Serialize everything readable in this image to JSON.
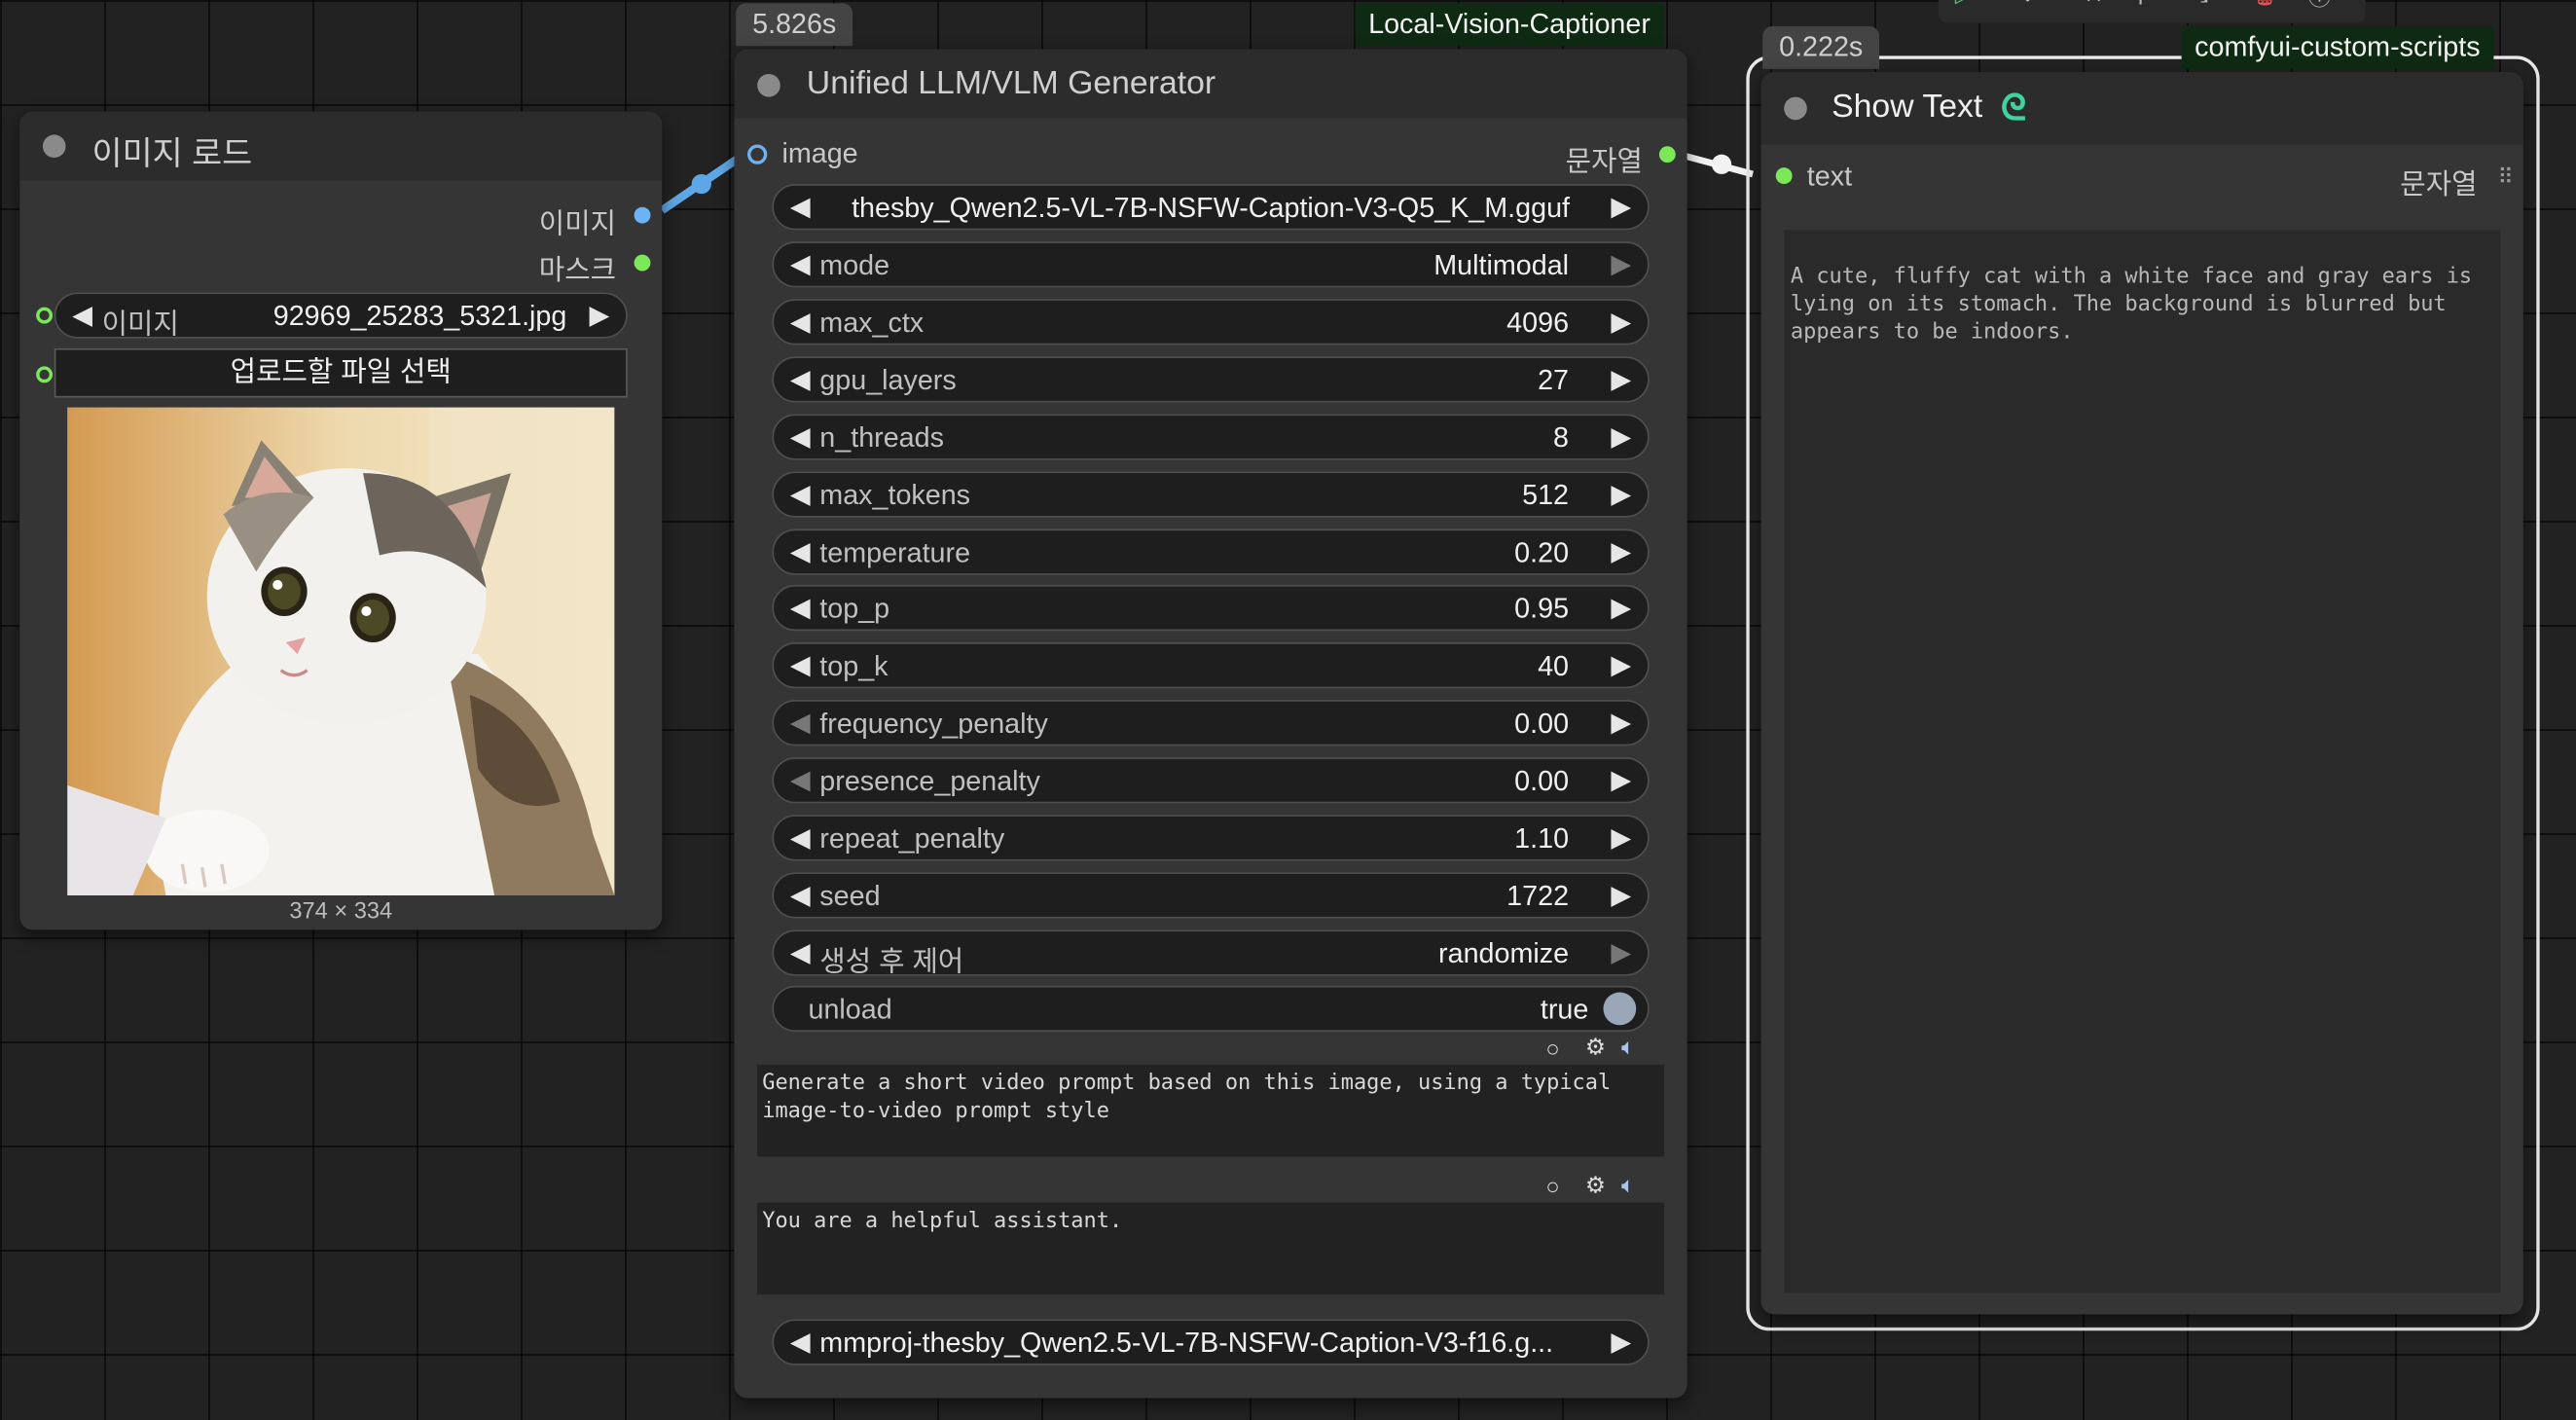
{
  "load_image": {
    "title": "이미지 로드",
    "outputs": [
      "이미지",
      "마스크"
    ],
    "image_widget_label": "이미지",
    "image_widget_value": "92969_25283_5321.jpg",
    "upload_button": "업로드할 파일 선택",
    "image_size": "374 × 334"
  },
  "generator": {
    "timing": "5.826s",
    "group_tag": "Local-Vision-Captioner",
    "title": "Unified LLM/VLM Generator",
    "input_label": "image",
    "output_label": "문자열",
    "model": "thesby_Qwen2.5-VL-7B-NSFW-Caption-V3-Q5_K_M.gguf",
    "params": [
      {
        "name": "mode",
        "value": "Multimodal"
      },
      {
        "name": "max_ctx",
        "value": "4096"
      },
      {
        "name": "gpu_layers",
        "value": "27"
      },
      {
        "name": "n_threads",
        "value": "8"
      },
      {
        "name": "max_tokens",
        "value": "512"
      },
      {
        "name": "temperature",
        "value": "0.20"
      },
      {
        "name": "top_p",
        "value": "0.95"
      },
      {
        "name": "top_k",
        "value": "40"
      },
      {
        "name": "frequency_penalty",
        "value": "0.00"
      },
      {
        "name": "presence_penalty",
        "value": "0.00"
      },
      {
        "name": "repeat_penalty",
        "value": "1.10"
      },
      {
        "name": "seed",
        "value": "1722"
      },
      {
        "name": "생성 후 제어",
        "value": "randomize"
      }
    ],
    "unload_label": "unload",
    "unload_value": "true",
    "prompt": "Generate a short video prompt based on this image, using a typical image-to-video prompt style",
    "system_prompt": "You are a helpful assistant.",
    "mmproj": "mmproj-thesby_Qwen2.5-VL-7B-NSFW-Caption-V3-f16.g..."
  },
  "show_text": {
    "timing": "0.222s",
    "group_tag": "comfyui-custom-scripts",
    "title": "Show Text",
    "input_label": "text",
    "output_label": "문자열",
    "text": "A cute, fluffy cat with a white face and gray ears is lying on its stomach. The background is blurred but appears to be indoors."
  },
  "icons": [
    "play-icon",
    "record-icon",
    "wrench-icon",
    "pin-icon",
    "collapse-icon",
    "trash-icon",
    "help-icon",
    "gear-icon",
    "speaker-icon",
    "drag-handle-icon"
  ],
  "colors": {
    "image_slot": "#6bb3f5",
    "string_slot": "#7be85a",
    "group_tag_bg": "#0f2a12",
    "canvas_bg": "#222222",
    "node_bg": "#353535"
  }
}
